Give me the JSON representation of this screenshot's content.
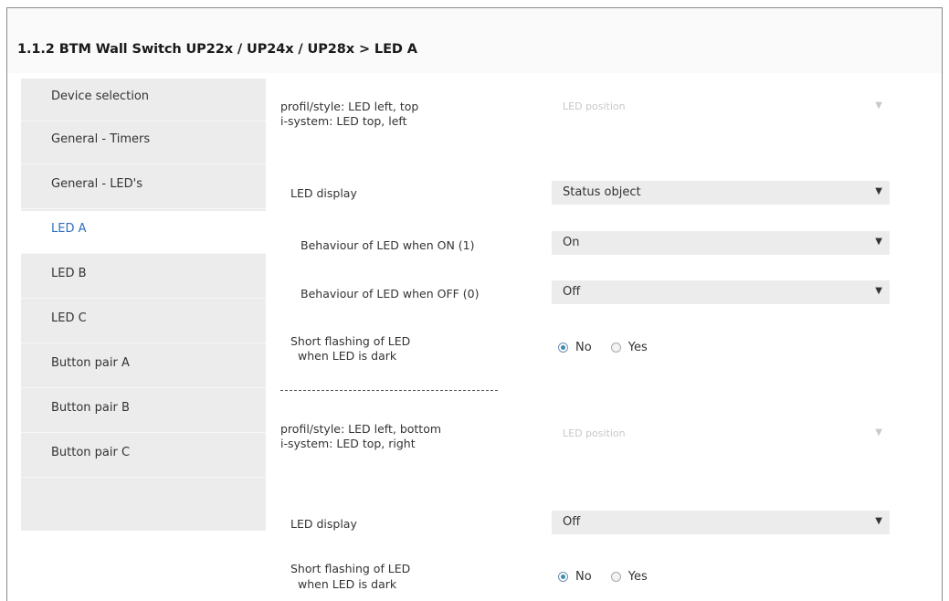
{
  "window": {
    "breadcrumb": "1.1.2 BTM Wall Switch UP22x / UP24x / UP28x > LED A"
  },
  "sidebar": {
    "items": [
      {
        "label": "Device selection"
      },
      {
        "label": "General - Timers"
      },
      {
        "label": "General - LED's"
      },
      {
        "label": "LED A"
      },
      {
        "label": "LED B"
      },
      {
        "label": "LED C"
      },
      {
        "label": "Button pair A"
      },
      {
        "label": "Button pair B"
      },
      {
        "label": "Button pair C"
      }
    ],
    "active": "LED A"
  },
  "section1": {
    "info_line1": "profil/style: LED left, top",
    "info_line2": "i-system: LED top, left",
    "position_select": "LED position",
    "led_display_label": "LED display",
    "led_display_value": "Status object",
    "behaviour_on_label": "Behaviour of LED when ON (1)",
    "behaviour_on_value": "On",
    "behaviour_off_label": "Behaviour of LED when OFF (0)",
    "behaviour_off_value": "Off",
    "short_flash_line1": "Short flashing of LED",
    "short_flash_line2": "when LED is dark",
    "short_flash_no": "No",
    "short_flash_yes": "Yes",
    "short_flash_selected": "No"
  },
  "section2": {
    "info_line1": "profil/style: LED left, bottom",
    "info_line2": "i-system: LED top, right",
    "position_select": "LED position",
    "led_display_label": "LED display",
    "led_display_value": "Off",
    "short_flash_line1": "Short flashing of LED",
    "short_flash_line2": "when LED is dark",
    "short_flash_no": "No",
    "short_flash_yes": "Yes",
    "short_flash_selected": "No"
  },
  "colors": {
    "active_nav_text": "#2e6fbf",
    "nav_background": "#ececec",
    "radio_selected": "#3d8db3"
  },
  "icons": {
    "dropdown": "caret-down-icon"
  }
}
